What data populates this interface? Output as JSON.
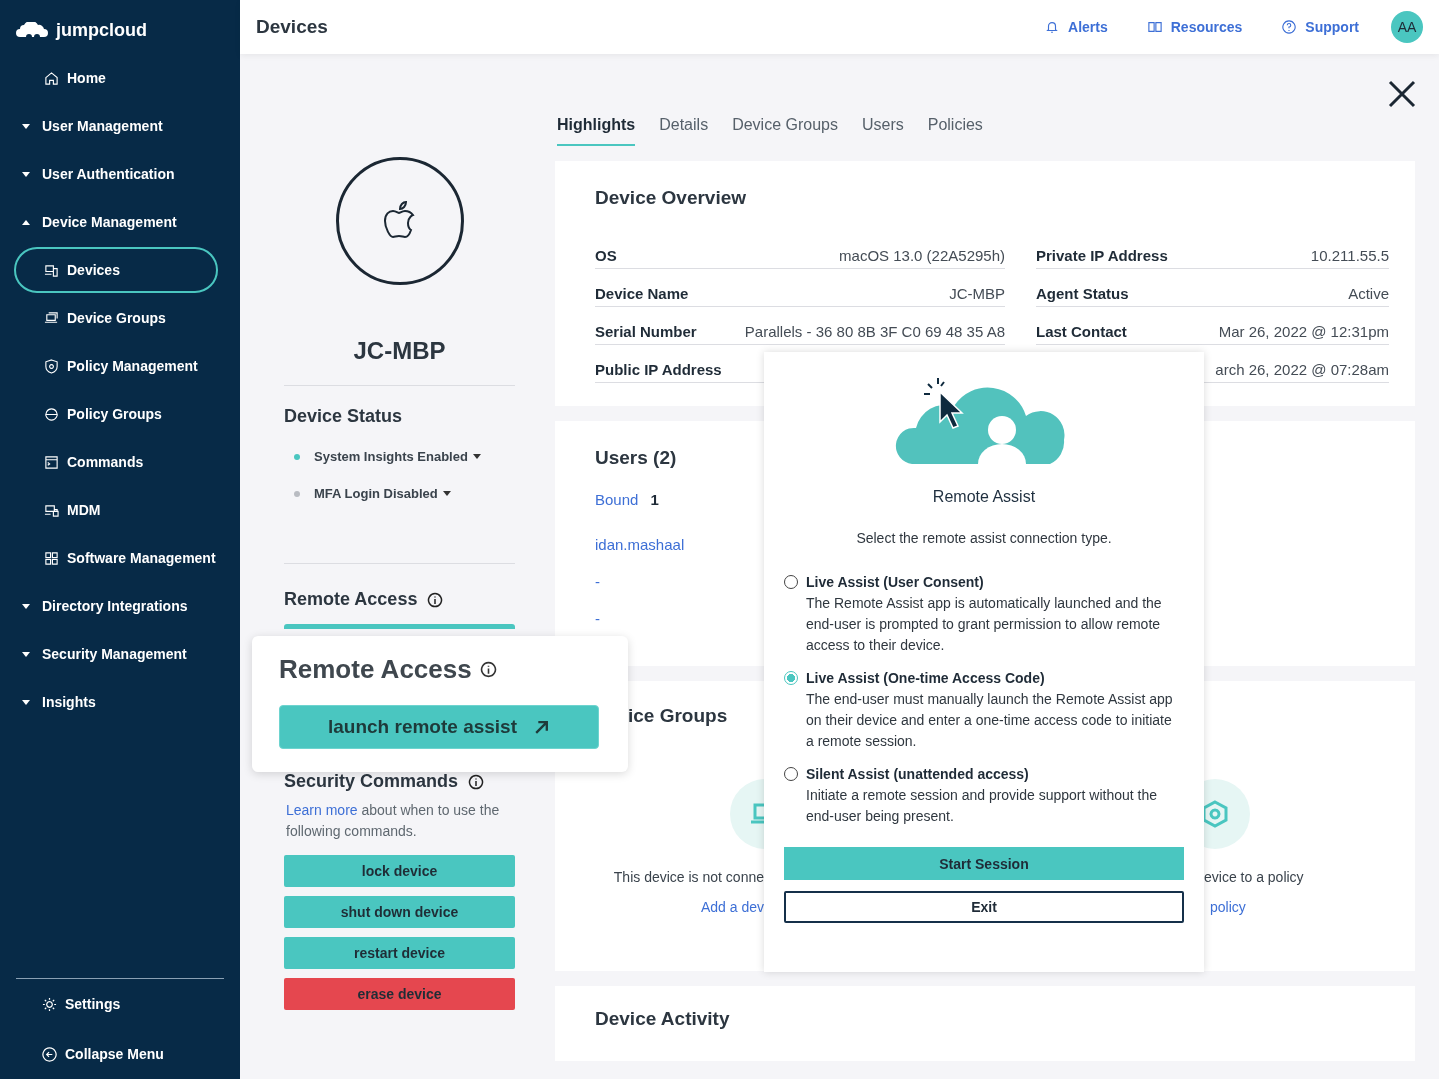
{
  "brand": {
    "name": "jumpcloud"
  },
  "sidebar": {
    "items": [
      {
        "kind": "link",
        "label": "Home",
        "selected": false
      },
      {
        "kind": "group",
        "label": "User Management",
        "expanded": false
      },
      {
        "kind": "group",
        "label": "User Authentication",
        "expanded": false
      },
      {
        "kind": "group",
        "label": "Device Management",
        "expanded": true,
        "children": [
          {
            "label": "Devices",
            "selected": true
          },
          {
            "label": "Device Groups",
            "selected": false
          },
          {
            "label": "Policy Management",
            "selected": false
          },
          {
            "label": "Policy Groups",
            "selected": false
          },
          {
            "label": "Commands",
            "selected": false
          },
          {
            "label": "MDM",
            "selected": false
          },
          {
            "label": "Software Management",
            "selected": false
          }
        ]
      },
      {
        "kind": "group",
        "label": "Directory Integrations",
        "expanded": false
      },
      {
        "kind": "group",
        "label": "Security Management",
        "expanded": false
      },
      {
        "kind": "group",
        "label": "Insights",
        "expanded": false
      }
    ],
    "footer": [
      "Settings",
      "Collapse Menu"
    ]
  },
  "header": {
    "title": "Devices",
    "links": [
      "Alerts",
      "Resources",
      "Support"
    ],
    "avatar": "AA"
  },
  "device": {
    "name": "JC-MBP"
  },
  "device_status": {
    "title": "Device Status",
    "items": [
      {
        "label": "System Insights Enabled",
        "on": true
      },
      {
        "label": "MFA Login Disabled",
        "on": false
      }
    ]
  },
  "remote_access": {
    "title": "Remote Access"
  },
  "callout": {
    "title": "Remote Access",
    "button": "launch remote assist"
  },
  "security_commands": {
    "title": "Security Commands",
    "link": "Learn more",
    "text": "about when to use the following commands.",
    "buttons": [
      {
        "label": "lock device",
        "kind": "normal"
      },
      {
        "label": "shut down device",
        "kind": "normal"
      },
      {
        "label": "restart device",
        "kind": "normal"
      },
      {
        "label": "erase device",
        "kind": "danger"
      }
    ]
  },
  "tabs": [
    {
      "label": "Highlights",
      "selected": true
    },
    {
      "label": "Details",
      "selected": false
    },
    {
      "label": "Device Groups",
      "selected": false
    },
    {
      "label": "Users",
      "selected": false
    },
    {
      "label": "Policies",
      "selected": false
    }
  ],
  "overview": {
    "title": "Device Overview",
    "left": [
      {
        "label": "OS",
        "value": "macOS 13.0 (22A5295h)"
      },
      {
        "label": "Device Name",
        "value": "JC-MBP"
      },
      {
        "label": "Serial Number",
        "value": "Parallels - 36 80 8B 3F C0 69 48 35 A8"
      },
      {
        "label": "Public IP Address"
      }
    ],
    "right": [
      {
        "label": "Private IP Address",
        "value": "10.211.55.5"
      },
      {
        "label": "Agent Status",
        "value": "Active"
      },
      {
        "label": "Last Contact",
        "value": "Mar 26, 2022 @ 12:31pm"
      },
      {
        "value": "arch 26, 2022 @ 07:28am"
      }
    ]
  },
  "users": {
    "title": "Users (2)",
    "bound_label": "Bound",
    "bound_count": "1",
    "list": [
      "idan.mashaal",
      "-",
      "-"
    ]
  },
  "groups": {
    "title": "ice Groups",
    "left_text": "This device is not conne",
    "left_link": "Add a dev",
    "right_text": "evice to a policy",
    "right_link": "policy"
  },
  "activity": {
    "title": "Device Activity"
  },
  "modal": {
    "title": "Remote Assist",
    "prompt": "Select the remote assist connection type.",
    "options": [
      {
        "label": "Live Assist (User Consent)",
        "description": "The Remote Assist app is automatically launched and the end-user is prompted to grant permission to allow remote access to their device.",
        "selected": false
      },
      {
        "label": "Live Assist (One-time Access Code)",
        "description": "The end-user must manually launch the Remote Assist app on their device and enter a one-time access code to initiate a remote session.",
        "selected": true
      },
      {
        "label": "Silent Assist (unattended access)",
        "description": "Initiate a remote session and provide support without the end-user being present.",
        "selected": false
      }
    ],
    "primary": "Start Session",
    "secondary": "Exit"
  }
}
